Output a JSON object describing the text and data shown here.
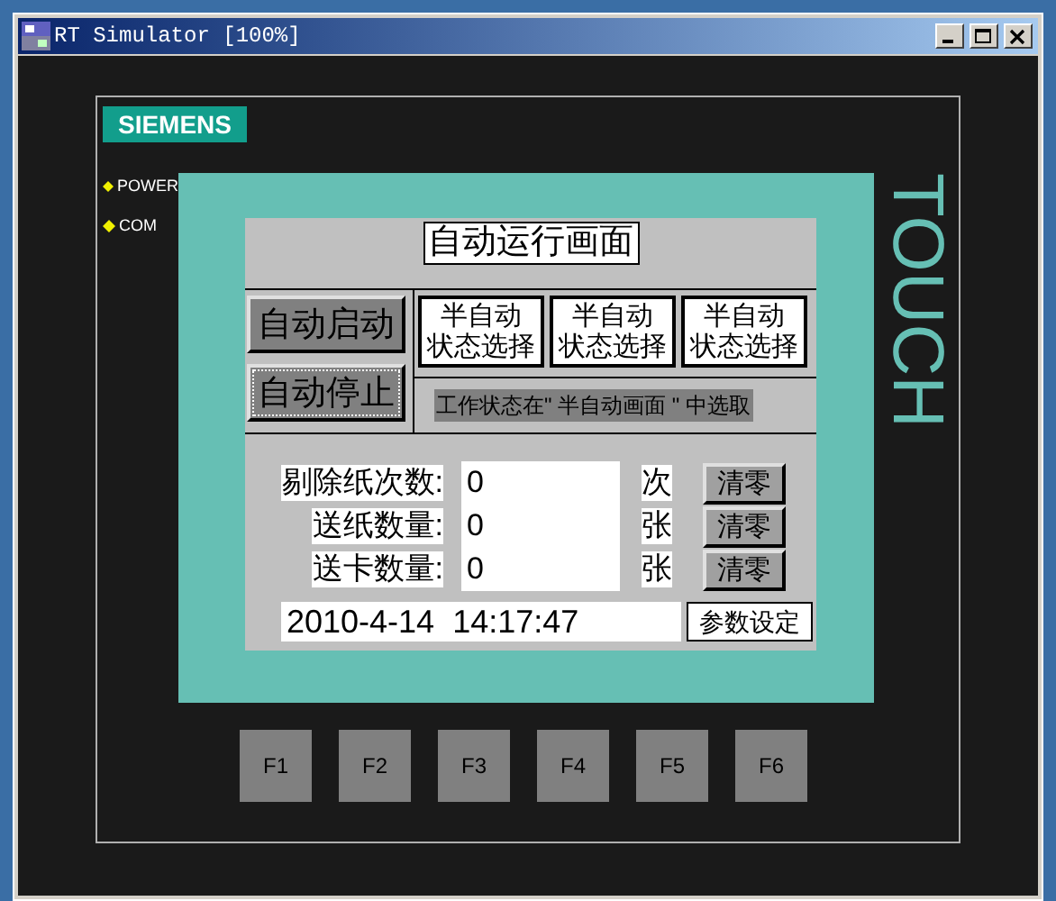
{
  "window": {
    "title": "RT Simulator [100%]"
  },
  "panel": {
    "logo": "SIEMENS",
    "indicators": [
      "POWER",
      "COM"
    ],
    "brand": "TOUCH"
  },
  "screen": {
    "title": "自动运行画面",
    "auto_buttons": [
      {
        "label": "自动启动",
        "focused": false
      },
      {
        "label": "自动停止",
        "focused": true
      }
    ],
    "mode_buttons": [
      {
        "line1": "半自动",
        "line2": "状态选择"
      },
      {
        "line1": "半自动",
        "line2": "状态选择"
      },
      {
        "line1": "半自动",
        "line2": "状态选择"
      }
    ],
    "notice": "工作状态在\" 半自动画面 \" 中选取",
    "counters": [
      {
        "label": "剔除纸次数:",
        "value": "0",
        "unit": "次",
        "button": "清零"
      },
      {
        "label": "送纸数量:",
        "value": "0",
        "unit": "张",
        "button": "清零"
      },
      {
        "label": "送卡数量:",
        "value": "0",
        "unit": "张",
        "button": "清零"
      }
    ],
    "datetime": "2010-4-14  14:17:47",
    "settings_button": "参数设定"
  },
  "function_keys": [
    "F1",
    "F2",
    "F3",
    "F4",
    "F5",
    "F6"
  ]
}
